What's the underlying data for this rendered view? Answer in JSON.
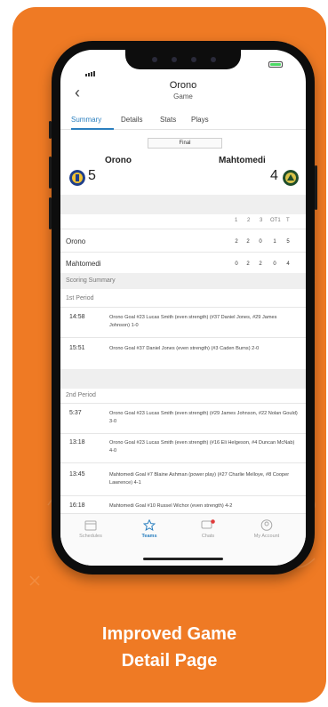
{
  "status": {
    "time": ""
  },
  "header": {
    "title": "Orono",
    "subtitle": "Game"
  },
  "tabs": [
    {
      "label": "Summary"
    },
    {
      "label": "Details"
    },
    {
      "label": "Stats"
    },
    {
      "label": "Plays"
    }
  ],
  "game": {
    "status": "Final",
    "home": {
      "name": "Orono",
      "score": "5"
    },
    "away": {
      "name": "Mahtomedi",
      "score": "4"
    }
  },
  "linescore": {
    "headers": [
      "1",
      "2",
      "3",
      "OT1",
      "T"
    ],
    "rows": [
      {
        "team": "Orono",
        "values": [
          "2",
          "2",
          "0",
          "1",
          "5"
        ]
      },
      {
        "team": "Mahtomedi",
        "values": [
          "0",
          "2",
          "2",
          "0",
          "4"
        ]
      }
    ]
  },
  "scoring": {
    "title": "Scoring Summary",
    "periods": [
      {
        "label": "1st Period",
        "events": [
          {
            "time": "14:58",
            "desc": "Orono Goal #23 Lucas Smith (even strength) (#37 Daniel Jones, #29 James Johnson) 1-0"
          },
          {
            "time": "15:51",
            "desc": "Orono Goal #37 Daniel Jones (even strength) (#3 Caden Burns) 2-0"
          }
        ]
      },
      {
        "label": "2nd Period",
        "events": [
          {
            "time": "5:37",
            "desc": "Orono Goal #23 Lucas Smith (even strength) (#29 James Johnson, #22 Nolan Gould) 3-0"
          },
          {
            "time": "13:18",
            "desc": "Orono Goal #23 Lucas Smith (even strength) (#16 Eli Helgeson, #4 Duncan McNab) 4-0"
          },
          {
            "time": "13:45",
            "desc": "Mahtomedi Goal #7 Blaine Ashman (power play) (#27 Charlie Melloye, #8 Cooper Lawrence) 4-1"
          },
          {
            "time": "16:18",
            "desc": "Mahtomedi Goal #10 Russel Wichor (even strength) 4-2"
          }
        ]
      }
    ]
  },
  "tabbar": [
    {
      "label": "Schedules"
    },
    {
      "label": "Teams"
    },
    {
      "label": "Chats"
    },
    {
      "label": "My Account"
    }
  ],
  "caption": {
    "line1": "Improved Game",
    "line2": "Detail Page"
  },
  "colors": {
    "accent": "#2a7fbf",
    "background": "#ef7a24",
    "badge": "#e03b3b"
  }
}
